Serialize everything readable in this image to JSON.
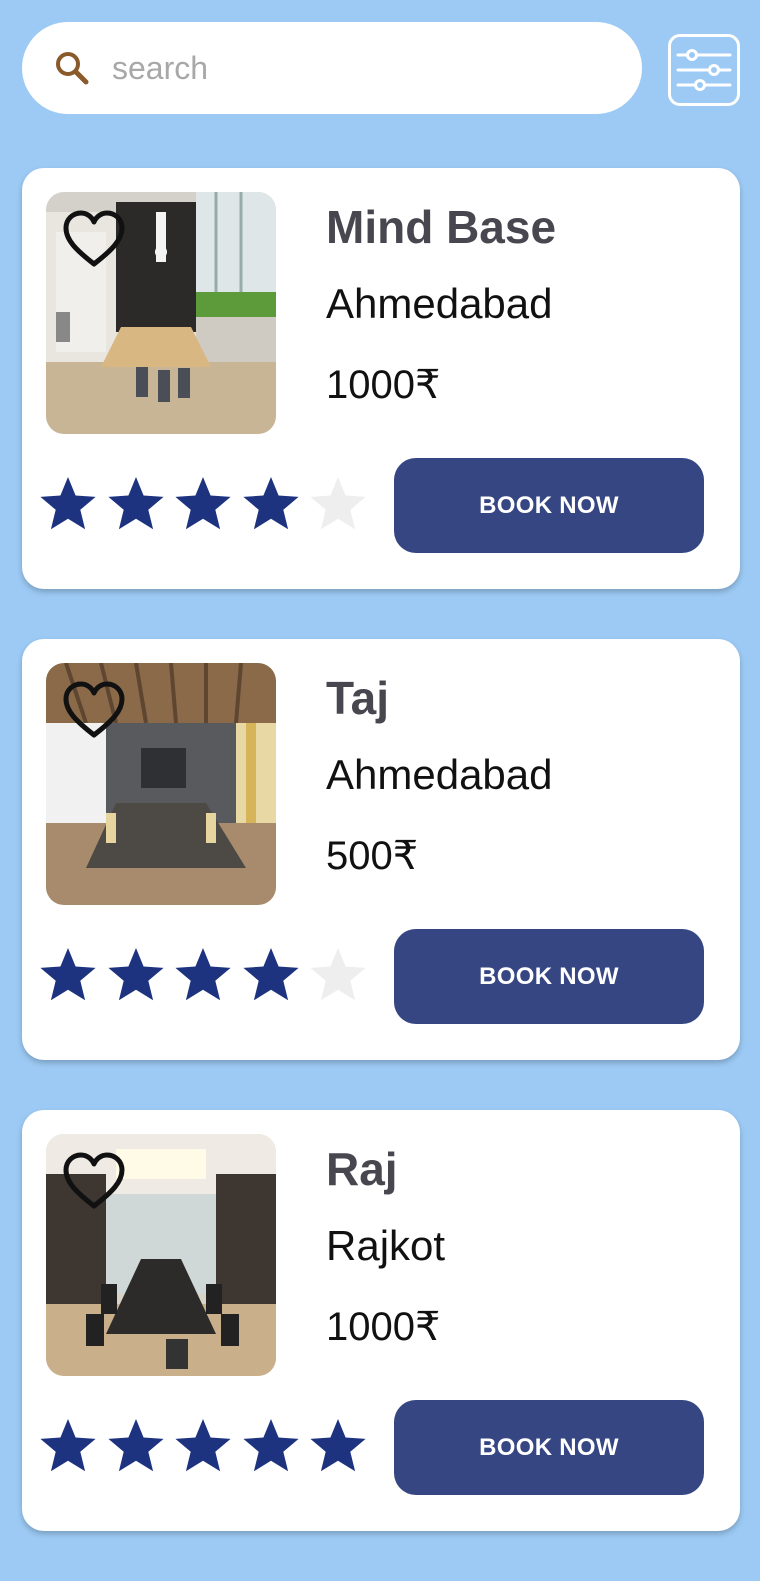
{
  "search": {
    "placeholder": "search",
    "value": ""
  },
  "colors": {
    "background": "#9ccaf4",
    "card": "#ffffff",
    "button": "#354682",
    "star_filled": "#1e3380",
    "star_empty": "#eeeeee",
    "title": "#48474f"
  },
  "venues": [
    {
      "name": "Mind Base",
      "city": "Ahmedabad",
      "price": "1000₹",
      "rating": 4,
      "max_rating": 5,
      "image": "office-room-with-plants",
      "button_label": "BOOK NOW"
    },
    {
      "name": "Taj",
      "city": "Ahmedabad",
      "price": "500₹",
      "rating": 4,
      "max_rating": 5,
      "image": "conference-room-wood-ceiling",
      "button_label": "BOOK NOW"
    },
    {
      "name": "Raj",
      "city": "Rajkot",
      "price": "1000₹",
      "rating": 5,
      "max_rating": 5,
      "image": "boardroom-long-table",
      "button_label": "BOOK NOW"
    }
  ]
}
